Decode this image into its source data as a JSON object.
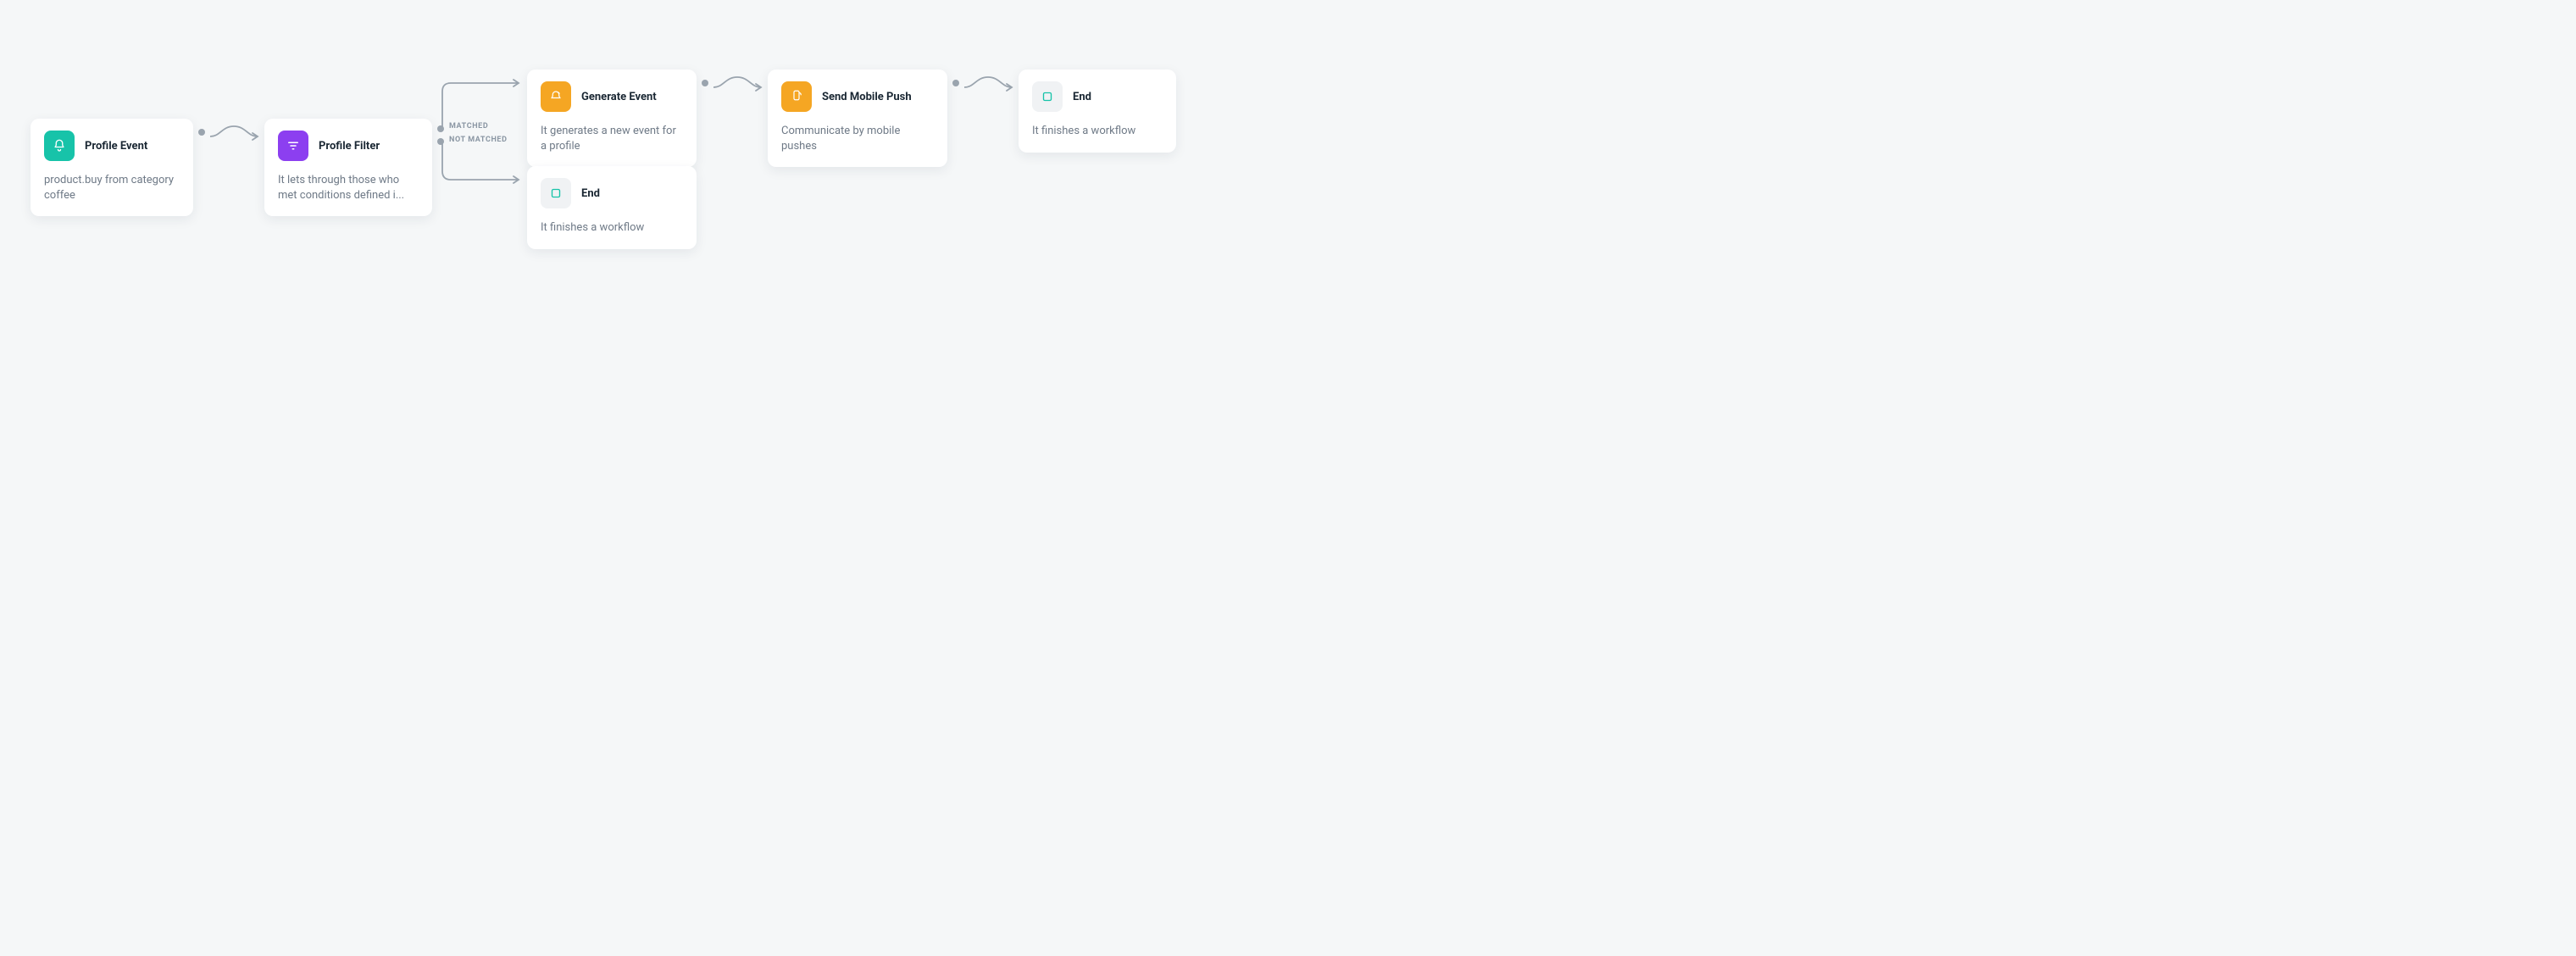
{
  "nodes": {
    "profile_event": {
      "title": "Profile Event",
      "desc": "product.buy from category coffee"
    },
    "profile_filter": {
      "title": "Profile Filter",
      "desc": "It lets through those who met conditions defined i..."
    },
    "generate_event": {
      "title": "Generate Event",
      "desc": "It generates a new event for a profile"
    },
    "send_push": {
      "title": "Send Mobile Push",
      "desc": "Communicate by mobile pushes"
    },
    "end_top": {
      "title": "End",
      "desc": "It finishes a workflow"
    },
    "end_bottom": {
      "title": "End",
      "desc": "It finishes a workflow"
    }
  },
  "branch": {
    "matched": "MATCHED",
    "not_matched": "NOT MATCHED"
  },
  "colors": {
    "teal": "#17c3a9",
    "purple": "#8c3ff0",
    "orange": "#f5a623",
    "grey": "#f0f2f4",
    "tealOutline": "#17c3a9"
  }
}
